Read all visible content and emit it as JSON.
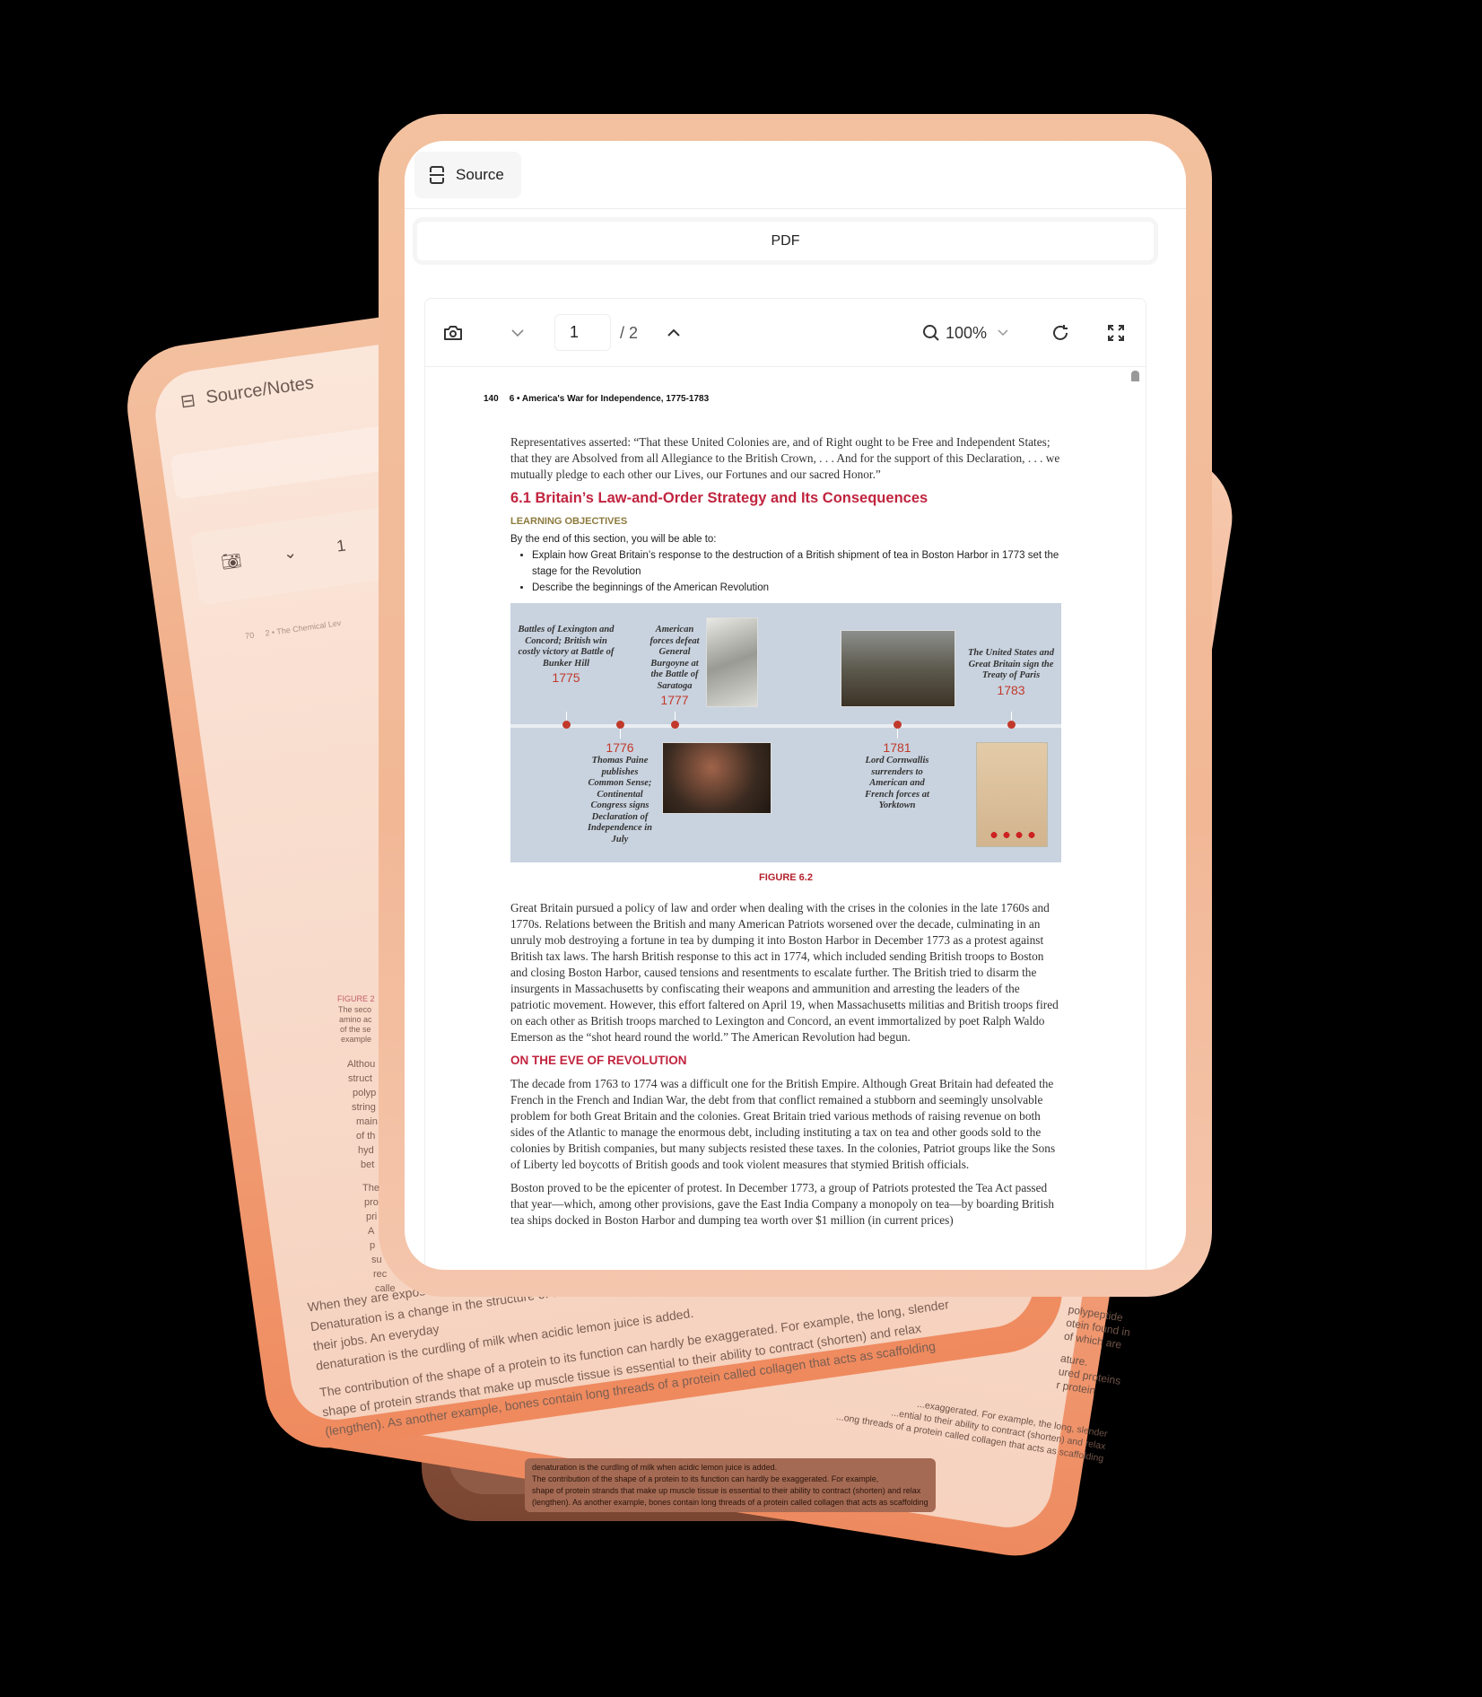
{
  "background_cards": {
    "left": {
      "tab_label": "Source/Notes",
      "pdf_label": "PDF",
      "page_value": "1",
      "page_number": "70",
      "running_head": "2 • The Chemical Lev",
      "figure_label": "FIGURE 2",
      "fragments": [
        "The seco",
        "amino ac",
        "of the se",
        "example",
        "Althou",
        "struct",
        "polyp",
        "string",
        "main",
        "of th",
        "hyd",
        "bet",
        "The",
        "pro",
        "pri",
        "A",
        "p",
        "su",
        "rec",
        "calle"
      ],
      "bottom_text": [
        "When they are exposed to extr...",
        "Denaturation is a change in the structure of a molecule ... lose their functional shape and are no longer able to carry out their jobs. An everyday",
        "denaturation is the curdling of milk when acidic lemon juice is added.",
        "The contribution of the shape of a protein to its function can hardly be exaggerated. For example, the long, slender",
        "shape of protein strands that make up muscle tissue is essential to their ability to contract (shorten) and relax",
        "(lengthen). As another example, bones contain long threads of a protein called collagen that acts as scaffolding"
      ]
    },
    "right": {
      "fragments": [
        "polypeptide",
        "otein found in",
        "of which are",
        "ature.",
        "ured proteins",
        "r protein"
      ],
      "bottom_text": [
        "...exaggerated. For example, the long, slender",
        "...ential to their ability to contract (shorten) and relax",
        "...ong threads of a protein called collagen that acts as scaffolding"
      ]
    },
    "dark": {
      "text": [
        "denaturation is the curdling of milk when acidic lemon juice is added.",
        "The contribution of the shape of a protein to its function can hardly be exaggerated. For example,",
        "shape of protein strands that make up muscle tissue is essential to their ability to contract (shorten) and relax",
        "(lengthen). As another example, bones contain long threads of a protein called collagen that acts as scaffolding"
      ]
    }
  },
  "panel": {
    "tab_label": "Source",
    "tab_icon": "scan-icon",
    "pdf_label": "PDF"
  },
  "toolbar": {
    "page_value": "1",
    "page_total": "/ 2",
    "zoom": "100%"
  },
  "document": {
    "page_number": "140",
    "running_head": "6 • America's War for Independence, 1775-1783",
    "intro": "Representatives asserted: “That these United Colonies are, and of Right ought to be Free and Independent States; that they are Absolved from all Allegiance to the British Crown, . . . And for the support of this Declaration, . . . we mutually pledge to each other our Lives, our Fortunes and our sacred Honor.”",
    "section_title": "6.1 Britain’s Law-and-Order Strategy and Its Consequences",
    "objectives_label": "LEARNING OBJECTIVES",
    "objectives_intro": "By the end of this section, you will be able to:",
    "objectives": [
      "Explain how Great Britain’s response to the destruction of a British shipment of tea in Boston Harbor in 1773 set the stage for the Revolution",
      "Describe the beginnings of the American Revolution"
    ],
    "timeline": [
      {
        "year": "1775",
        "text": "Battles of Lexington and Concord; British win costly victory at Battle of Bunker Hill"
      },
      {
        "year": "1776",
        "text": "Thomas Paine publishes Common Sense; Continental Congress signs Declaration of Independence in July"
      },
      {
        "year": "1777",
        "text": "American forces defeat General Burgoyne at the Battle of Saratoga"
      },
      {
        "year": "1781",
        "text": "Lord Cornwallis surrenders to American and French forces at Yorktown"
      },
      {
        "year": "1783",
        "text": "The United States and Great Britain sign the Treaty of Paris"
      }
    ],
    "figure_caption": "FIGURE 6.2",
    "para1": "Great Britain pursued a policy of law and order when dealing with the crises in the colonies in the late 1760s and 1770s. Relations between the British and many American Patriots worsened over the decade, culminating in an unruly mob destroying a fortune in tea by dumping it into Boston Harbor in December 1773 as a protest against British tax laws. The harsh British response to this act in 1774, which included sending British troops to Boston and closing Boston Harbor, caused tensions and resentments to escalate further. The British tried to disarm the insurgents in Massachusetts by confiscating their weapons and ammunition and arresting the leaders of the patriotic movement. However, this effort faltered on April 19, when Massachusetts militias and British troops fired on each other as British troops marched to Lexington and Concord, an event immortalized by poet Ralph Waldo Emerson as the “shot heard round the world.” The American Revolution had begun.",
    "subheading": "ON THE EVE OF REVOLUTION",
    "para2": "The decade from 1763 to 1774 was a difficult one for the British Empire. Although Great Britain had defeated the French in the French and Indian War, the debt from that conflict remained a stubborn and seemingly unsolvable problem for both Great Britain and the colonies. Great Britain tried various methods of raising revenue on both sides of the Atlantic to manage the enormous debt, including instituting a tax on tea and other goods sold to the colonies by British companies, but many subjects resisted these taxes. In the colonies, Patriot groups like the Sons of Liberty led boycotts of British goods and took violent measures that stymied British officials.",
    "para3": "Boston proved to be the epicenter of protest. In December 1773, a group of Patriots protested the Tea Act passed that year—which, among other provisions, gave the East India Company a monopoly on tea—by boarding British tea ships docked in Boston Harbor and dumping tea worth over $1 million (in current prices)"
  },
  "colors": {
    "accent_red": "#c1243f",
    "objectives_olive": "#8c7a3d",
    "frame_peach": "#f3c19f",
    "frame_orange": "#ef8a5e",
    "timeline_bg": "#c9d3df"
  }
}
